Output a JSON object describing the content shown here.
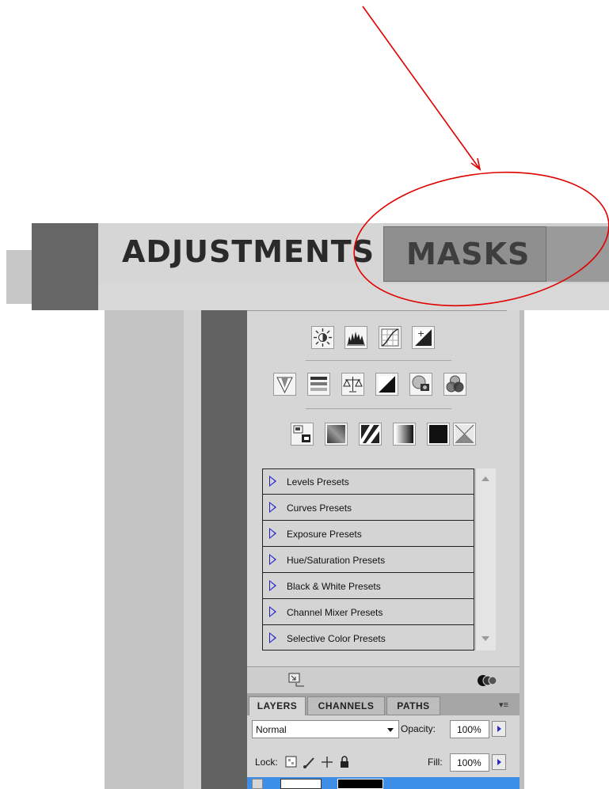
{
  "zoomed_tabs": {
    "adjustments": "ADJUSTMENTS",
    "masks": "MASKS"
  },
  "annotation": {
    "color": "#e00000",
    "shape": "circle-and-arrow"
  },
  "adjustment_icons": {
    "row1": [
      "brightness-contrast-icon",
      "levels-icon",
      "curves-icon",
      "exposure-icon"
    ],
    "row2": [
      "vibrance-icon",
      "hue-saturation-icon",
      "color-balance-icon",
      "black-white-icon",
      "photo-filter-icon",
      "channel-mixer-icon"
    ],
    "row3": [
      "invert-icon",
      "posterize-icon",
      "threshold-icon",
      "gradient-map-icon",
      "selective-color-icon"
    ]
  },
  "presets": [
    "Levels Presets",
    "Curves Presets",
    "Exposure Presets",
    "Hue/Saturation Presets",
    "Black & White Presets",
    "Channel Mixer Presets",
    "Selective Color Presets"
  ],
  "layers_panel": {
    "tabs": [
      "LAYERS",
      "CHANNELS",
      "PATHS"
    ],
    "menu_glyph": "▾≡",
    "blend_mode": "Normal",
    "opacity_label": "Opacity:",
    "opacity_value": "100%",
    "lock_label": "Lock:",
    "fill_label": "Fill:",
    "fill_value": "100%"
  }
}
